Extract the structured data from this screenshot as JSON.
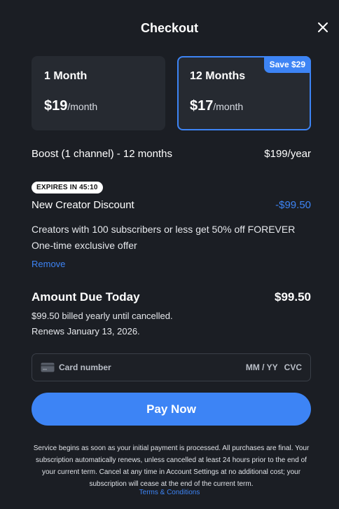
{
  "header": {
    "title": "Checkout"
  },
  "plans": [
    {
      "name": "1 Month",
      "price": "$19",
      "unit": "/month"
    },
    {
      "name": "12 Months",
      "price": "$17",
      "unit": "/month",
      "badge": "Save $29"
    }
  ],
  "selected_plan": "12 Months",
  "line_item": {
    "label": "Boost (1 channel) - 12 months",
    "price": "$199/year"
  },
  "discount": {
    "expires": "EXPIRES IN 45:10",
    "label": "New Creator Discount",
    "amount": "-$99.50",
    "description": "Creators with 100 subscribers or less get 50% off FOREVER",
    "subtext": "One-time exclusive offer",
    "remove_label": "Remove"
  },
  "total": {
    "label": "Amount Due Today",
    "amount": "$99.50",
    "billed": "$99.50 billed yearly until cancelled.",
    "renews": "Renews January 13, 2026."
  },
  "card": {
    "number_placeholder": "Card number",
    "expiry_placeholder": "MM / YY",
    "cvc_placeholder": "CVC"
  },
  "pay_button": "Pay Now",
  "legal": "Service begins as soon as your initial payment is processed. All purchases are final. Your subscription automatically renews, unless cancelled at least 24 hours prior to the end of your current term. Cancel at any time in Account Settings at no additional cost; your subscription will cease at the end of the current term.",
  "terms_link": "Terms & Conditions",
  "colors": {
    "background": "#1b1e24",
    "card": "#262a31",
    "accent": "#3d84f5"
  },
  "icons": {
    "close": "close-icon",
    "card": "credit-card-icon"
  }
}
